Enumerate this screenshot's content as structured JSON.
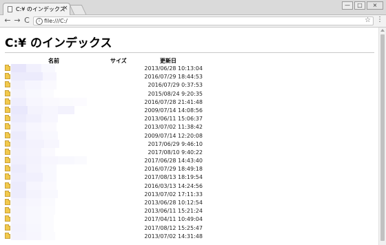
{
  "browser": {
    "tab_title": "C:¥ のインデックス",
    "tab_close": "×",
    "url": "file:///C:/",
    "window_controls": {
      "minimize": "—",
      "maximize": "□",
      "close": "×"
    },
    "nav": {
      "back": "←",
      "forward": "→",
      "reload": "C",
      "info": "i",
      "star": "☆",
      "menu": "⋮"
    }
  },
  "page": {
    "title": "C:¥ のインデックス",
    "headers": {
      "name": "名前",
      "size": "サイズ",
      "modified": "更新日"
    },
    "rows": [
      {
        "modified": "2013/06/28 10:13:04"
      },
      {
        "modified": "2016/07/29 18:44:53"
      },
      {
        "modified": "2016/07/29 0:37:53"
      },
      {
        "modified": "2015/08/24 9:20:35"
      },
      {
        "modified": "2016/07/28 21:41:48"
      },
      {
        "modified": "2009/07/14 14:08:56"
      },
      {
        "modified": "2013/06/11 15:06:37"
      },
      {
        "modified": "2013/07/02 11:38:42"
      },
      {
        "modified": "2009/07/14 12:20:08"
      },
      {
        "modified": "2017/06/29 9:46:10"
      },
      {
        "modified": "2017/08/10 9:40:22"
      },
      {
        "modified": "2017/06/28 14:43:40"
      },
      {
        "modified": "2016/07/29 18:49:18"
      },
      {
        "modified": "2017/08/13 18:19:54"
      },
      {
        "modified": "2016/03/13 14:24:56"
      },
      {
        "modified": "2013/07/02 17:11:33"
      },
      {
        "modified": "2013/06/28 10:12:54"
      },
      {
        "modified": "2013/06/11 15:21:24"
      },
      {
        "modified": "2017/04/11 10:49:04"
      },
      {
        "modified": "2017/08/12 15:25:47"
      },
      {
        "modified": "2013/07/02 14:31:48"
      }
    ]
  },
  "colors": {
    "folder": "#f2c94c",
    "redaction": "#e4e2fb"
  }
}
